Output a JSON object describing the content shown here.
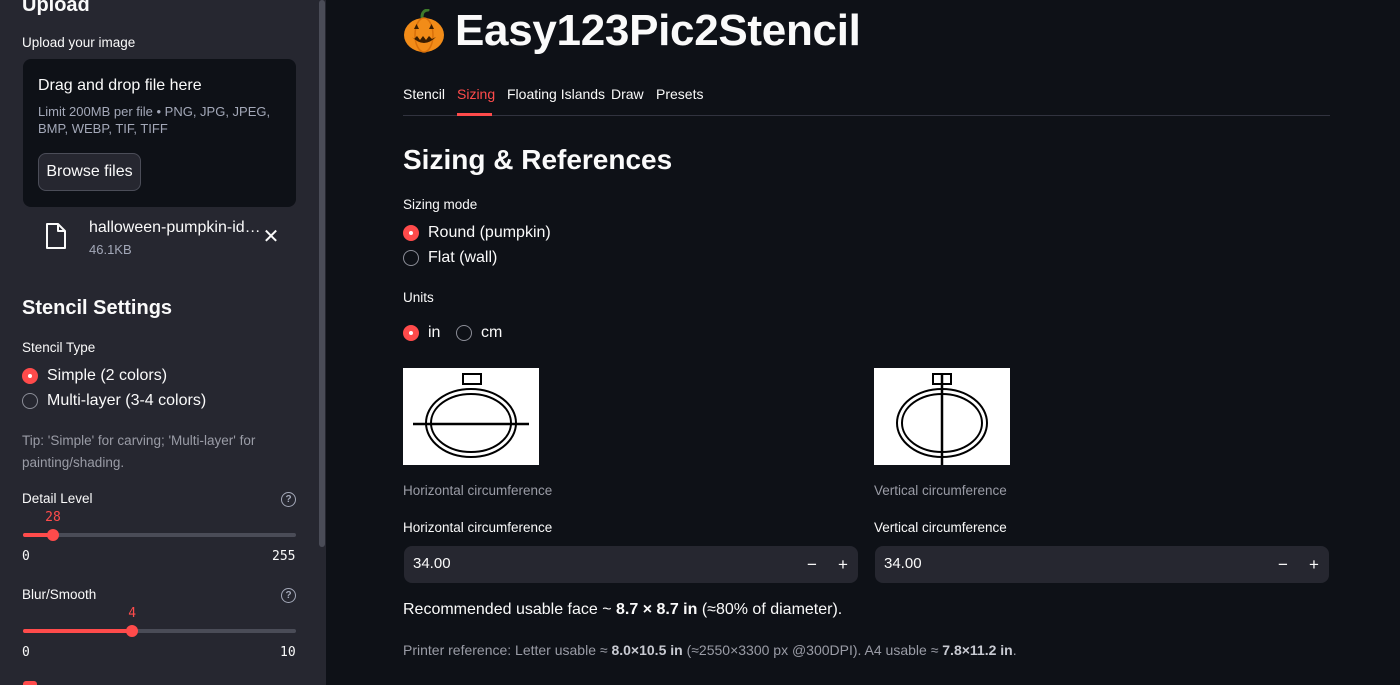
{
  "sidebar": {
    "upload_header": "Upload",
    "upload_label": "Upload your image",
    "dropzone": {
      "title": "Drag and drop file here",
      "hint": "Limit 200MB per file • PNG, JPG, JPEG, BMP, WEBP, TIF, TIFF",
      "browse_label": "Browse files"
    },
    "file": {
      "name": "halloween-pumpkin-ideas.jpg",
      "size": "46.1KB",
      "icon": "file-icon"
    },
    "settings_header": "Stencil Settings",
    "stencil_type": {
      "label": "Stencil Type",
      "options": [
        "Simple (2 colors)",
        "Multi-layer (3-4 colors)"
      ],
      "selected": "Simple (2 colors)"
    },
    "tip": "Tip: 'Simple' for carving; 'Multi-layer' for painting/shading.",
    "detail_level": {
      "label": "Detail Level",
      "value": 28,
      "min": 0,
      "max": 255
    },
    "blur_smooth": {
      "label": "Blur/Smooth",
      "value": 4,
      "min": 0,
      "max": 10
    }
  },
  "main": {
    "title_icon": "jack-o-lantern-icon",
    "title": "Easy123Pic2Stencil",
    "tabs": [
      {
        "label": "Stencil",
        "active": false
      },
      {
        "label": "Sizing",
        "active": true
      },
      {
        "label": "Floating Islands",
        "active": false
      },
      {
        "label": "Draw",
        "active": false
      },
      {
        "label": "Presets",
        "active": false
      }
    ],
    "section_title": "Sizing & References",
    "sizing_mode": {
      "label": "Sizing mode",
      "options": [
        "Round (pumpkin)",
        "Flat (wall)"
      ],
      "selected": "Round (pumpkin)"
    },
    "units": {
      "label": "Units",
      "options": [
        "in",
        "cm"
      ],
      "selected": "in"
    },
    "horizontal": {
      "caption": "Horizontal circumference",
      "input_label": "Horizontal circumference",
      "value": "34.00"
    },
    "vertical": {
      "caption": "Vertical circumference",
      "input_label": "Vertical circumference",
      "value": "34.00"
    },
    "recommended": {
      "prefix": "Recommended usable face ~ ",
      "size": "8.7 × 8.7 in",
      "suffix": " (≈80% of diameter)."
    },
    "printer": {
      "prefix": "Printer reference: Letter usable ≈ ",
      "letter_size": "8.0×10.5 in",
      "middle": " (≈2550×3300 px @300DPI). A4 usable ≈ ",
      "a4_size": "7.8×11.2 in",
      "suffix": "."
    },
    "colors": {
      "accent": "#ff4b4b",
      "background": "#0e1117",
      "sidebar": "#262730"
    }
  }
}
